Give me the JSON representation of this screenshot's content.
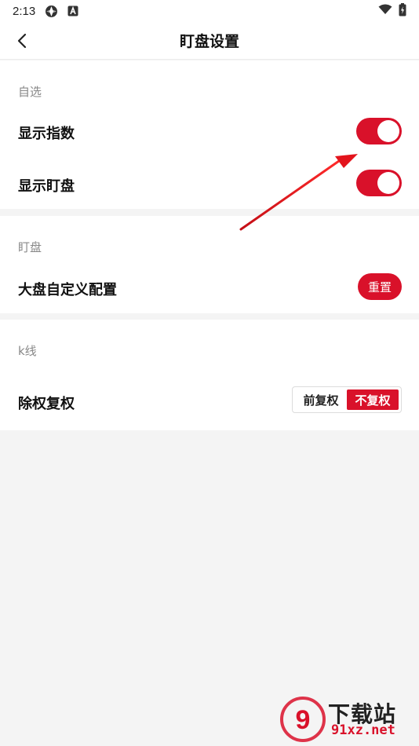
{
  "status_bar": {
    "time": "2:13"
  },
  "header": {
    "title": "盯盘设置"
  },
  "sections": [
    {
      "label": "自选",
      "rows": [
        {
          "label": "显示指数",
          "control": "toggle",
          "on": true
        },
        {
          "label": "显示盯盘",
          "control": "toggle",
          "on": true
        }
      ]
    },
    {
      "label": "盯盘",
      "rows": [
        {
          "label": "大盘自定义配置",
          "control": "button",
          "button_label": "重置"
        }
      ]
    },
    {
      "label": "k线",
      "rows": [
        {
          "label": "除权复权",
          "control": "segment",
          "options": [
            "前复权",
            "不复权"
          ],
          "selected": "不复权"
        }
      ]
    }
  ],
  "watermark": {
    "brand": "下载站",
    "site": "91xz.net",
    "logo_glyph": "9"
  },
  "colors": {
    "accent": "#d9112a",
    "background": "#f4f4f4",
    "card": "#ffffff",
    "section_label": "#888888"
  }
}
